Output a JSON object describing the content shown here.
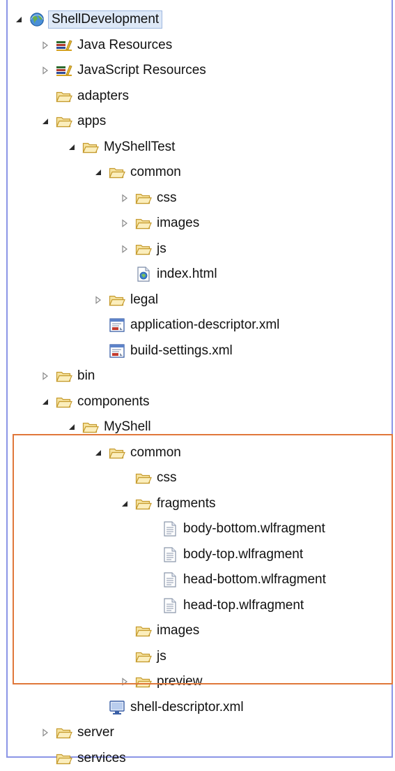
{
  "tree": [
    {
      "label": "ShellDevelopment",
      "depth": 0,
      "icon": "project-globe-icon",
      "twisty": "expanded",
      "selected": true
    },
    {
      "label": "Java Resources",
      "depth": 1,
      "icon": "library-icon",
      "twisty": "collapsed"
    },
    {
      "label": "JavaScript Resources",
      "depth": 1,
      "icon": "library-icon",
      "twisty": "collapsed"
    },
    {
      "label": "adapters",
      "depth": 1,
      "icon": "folder-icon",
      "twisty": "none"
    },
    {
      "label": "apps",
      "depth": 1,
      "icon": "folder-icon",
      "twisty": "expanded"
    },
    {
      "label": "MyShellTest",
      "depth": 2,
      "icon": "folder-icon",
      "twisty": "expanded"
    },
    {
      "label": "common",
      "depth": 3,
      "icon": "folder-icon",
      "twisty": "expanded"
    },
    {
      "label": "css",
      "depth": 4,
      "icon": "folder-icon",
      "twisty": "collapsed"
    },
    {
      "label": "images",
      "depth": 4,
      "icon": "folder-icon",
      "twisty": "collapsed"
    },
    {
      "label": "js",
      "depth": 4,
      "icon": "folder-icon",
      "twisty": "collapsed"
    },
    {
      "label": "index.html",
      "depth": 4,
      "icon": "html-file-icon",
      "twisty": "none"
    },
    {
      "label": "legal",
      "depth": 3,
      "icon": "folder-icon",
      "twisty": "collapsed"
    },
    {
      "label": "application-descriptor.xml",
      "depth": 3,
      "icon": "xml-descriptor-icon",
      "twisty": "none"
    },
    {
      "label": "build-settings.xml",
      "depth": 3,
      "icon": "xml-descriptor-icon",
      "twisty": "none"
    },
    {
      "label": "bin",
      "depth": 1,
      "icon": "folder-icon",
      "twisty": "collapsed"
    },
    {
      "label": "components",
      "depth": 1,
      "icon": "folder-icon",
      "twisty": "expanded"
    },
    {
      "label": "MyShell",
      "depth": 2,
      "icon": "folder-icon",
      "twisty": "expanded"
    },
    {
      "label": "common",
      "depth": 3,
      "icon": "folder-icon",
      "twisty": "expanded"
    },
    {
      "label": "css",
      "depth": 4,
      "icon": "folder-icon",
      "twisty": "none"
    },
    {
      "label": "fragments",
      "depth": 4,
      "icon": "folder-icon",
      "twisty": "expanded"
    },
    {
      "label": "body-bottom.wlfragment",
      "depth": 5,
      "icon": "text-file-icon",
      "twisty": "none"
    },
    {
      "label": "body-top.wlfragment",
      "depth": 5,
      "icon": "text-file-icon",
      "twisty": "none"
    },
    {
      "label": "head-bottom.wlfragment",
      "depth": 5,
      "icon": "text-file-icon",
      "twisty": "none"
    },
    {
      "label": "head-top.wlfragment",
      "depth": 5,
      "icon": "text-file-icon",
      "twisty": "none"
    },
    {
      "label": "images",
      "depth": 4,
      "icon": "folder-icon",
      "twisty": "none"
    },
    {
      "label": "js",
      "depth": 4,
      "icon": "folder-icon",
      "twisty": "none"
    },
    {
      "label": "preview",
      "depth": 4,
      "icon": "folder-icon",
      "twisty": "collapsed"
    },
    {
      "label": "shell-descriptor.xml",
      "depth": 3,
      "icon": "shell-descriptor-icon",
      "twisty": "none"
    },
    {
      "label": "server",
      "depth": 1,
      "icon": "folder-icon",
      "twisty": "collapsed"
    },
    {
      "label": "services",
      "depth": 1,
      "icon": "folder-icon",
      "twisty": "none"
    }
  ],
  "colors": {
    "frame_border": "#8b95e6",
    "highlight_border": "#e0773a",
    "folder_fill": "#f6e3a0",
    "folder_stroke": "#c59a2c",
    "selection_bg": "#dde8f7"
  }
}
